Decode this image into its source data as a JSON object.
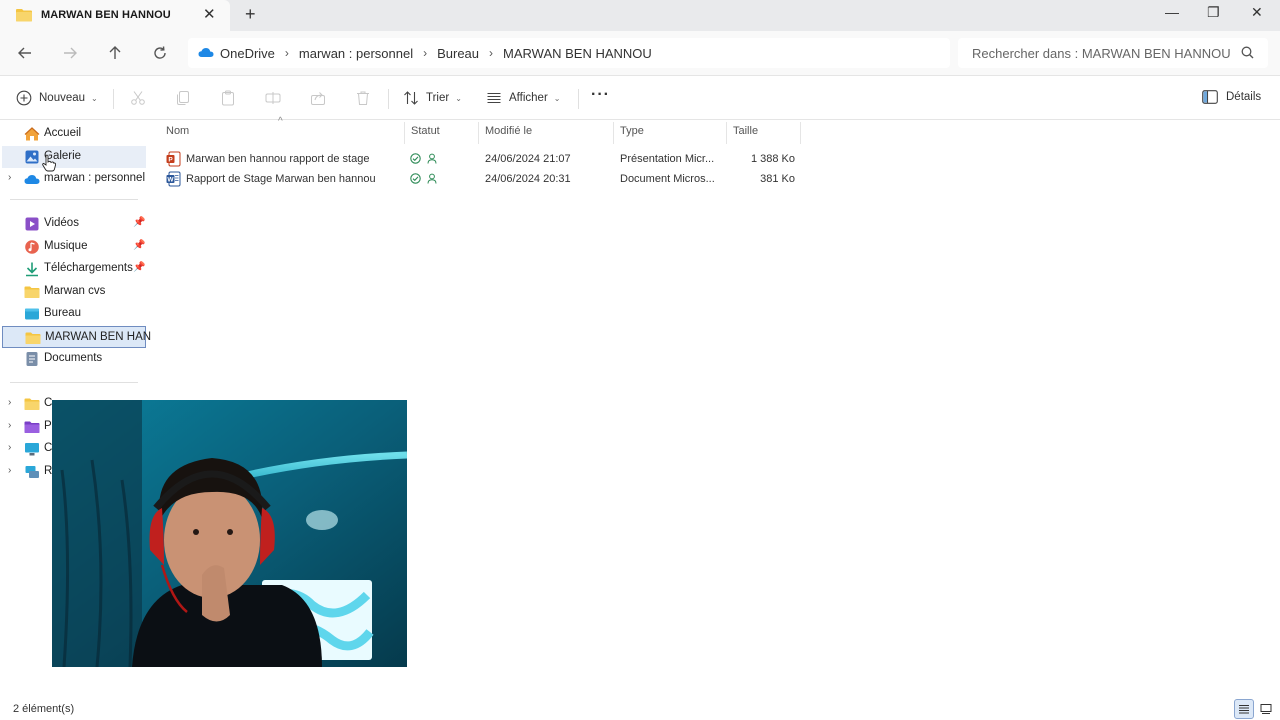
{
  "tab": {
    "title": "MARWAN BEN HANNOU",
    "close": "✕",
    "new": "+"
  },
  "window": {
    "minimize": "—",
    "restore": "❐",
    "close": "✕"
  },
  "breadcrumb": [
    "OneDrive",
    "marwan : personnel",
    "Bureau",
    "MARWAN BEN HANNOU"
  ],
  "search": {
    "placeholder": "Rechercher dans : MARWAN BEN HANNOU"
  },
  "toolbar": {
    "new_label": "Nouveau",
    "sort_label": "Trier",
    "view_label": "Afficher",
    "more_label": "···",
    "details_label": "Détails"
  },
  "sidebar": {
    "top": [
      {
        "label": "Accueil",
        "icon": "home-icon"
      },
      {
        "label": "Galerie",
        "icon": "gallery-icon"
      },
      {
        "label": "marwan : personnel",
        "icon": "onedrive-cloud-icon"
      }
    ],
    "quick": [
      {
        "label": "Vidéos",
        "icon": "videos-icon",
        "pinned": true
      },
      {
        "label": "Musique",
        "icon": "music-icon",
        "pinned": true
      },
      {
        "label": "Téléchargements",
        "icon": "downloads-icon",
        "pinned": true
      },
      {
        "label": "Marwan cvs",
        "icon": "folder-icon",
        "pinned": false
      },
      {
        "label": "Bureau",
        "icon": "desktop-icon",
        "pinned": false
      },
      {
        "label": "MARWAN BEN HAN",
        "icon": "folder-icon",
        "pinned": false
      },
      {
        "label": "Documents",
        "icon": "documents-icon",
        "pinned": false
      }
    ],
    "bottom": [
      {
        "label": "C",
        "icon": "folder-icon"
      },
      {
        "label": "P",
        "icon": "folder-purple-icon"
      },
      {
        "label": "C",
        "icon": "pc-icon"
      },
      {
        "label": "R",
        "icon": "network-icon"
      }
    ]
  },
  "columns": {
    "name": "Nom",
    "status": "Statut",
    "modified": "Modifié le",
    "type": "Type",
    "size": "Taille"
  },
  "files": [
    {
      "name": "Marwan ben hannou rapport de stage",
      "modified": "24/06/2024 21:07",
      "type": "Présentation Micr...",
      "size": "1 388 Ko",
      "kind": "powerpoint"
    },
    {
      "name": "Rapport de Stage Marwan ben hannou",
      "modified": "24/06/2024 20:31",
      "type": "Document Micros...",
      "size": "381 Ko",
      "kind": "word"
    }
  ],
  "status": {
    "count": "2 élément(s)"
  },
  "colors": {
    "accent": "#0067c0",
    "sync_ok": "#2e8b57",
    "ppt": "#c43e1c",
    "word": "#2b579a",
    "folder": "#f4c542"
  }
}
